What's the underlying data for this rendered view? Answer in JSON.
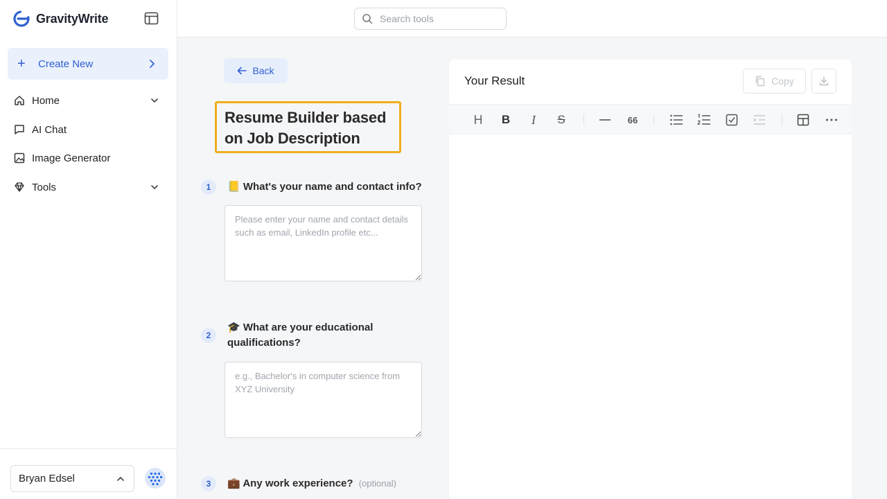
{
  "brand": {
    "name": "GravityWrite",
    "accent": "#2f5fd0"
  },
  "search": {
    "placeholder": "Search tools"
  },
  "sidebar": {
    "create_new": "Create New",
    "items": [
      {
        "label": "Home",
        "icon": "home-icon",
        "expandable": true
      },
      {
        "label": "AI Chat",
        "icon": "chat-icon",
        "expandable": false
      },
      {
        "label": "Image Generator",
        "icon": "image-icon",
        "expandable": false
      },
      {
        "label": "Tools",
        "icon": "gem-icon",
        "expandable": true
      }
    ],
    "user_name": "Bryan Edsel"
  },
  "form": {
    "back_label": "Back",
    "title": "Resume Builder based on Job Description",
    "steps": [
      {
        "number": "1",
        "emoji": "📒",
        "question": "What's your name and contact info?",
        "optional": "",
        "placeholder": "Please enter your name and contact details such as email, LinkedIn profile etc..."
      },
      {
        "number": "2",
        "emoji": "🎓",
        "question": "What are your educational qualifications?",
        "optional": "",
        "placeholder": "e.g., Bachelor's in computer science from XYZ University"
      },
      {
        "number": "3",
        "emoji": "💼",
        "question": "Any work experience?",
        "optional": "(optional)",
        "placeholder": ""
      }
    ]
  },
  "result": {
    "title": "Your Result",
    "copy_label": "Copy",
    "toolbar": [
      "heading",
      "bold",
      "italic",
      "strikethrough",
      "horizontal-rule",
      "quote",
      "bullet-list",
      "ordered-list",
      "task-list",
      "indent",
      "table",
      "more"
    ],
    "toolbar_glyphs": {
      "heading": "H",
      "bold": "B",
      "italic": "I",
      "strikethrough": "S",
      "quote": "66"
    }
  }
}
